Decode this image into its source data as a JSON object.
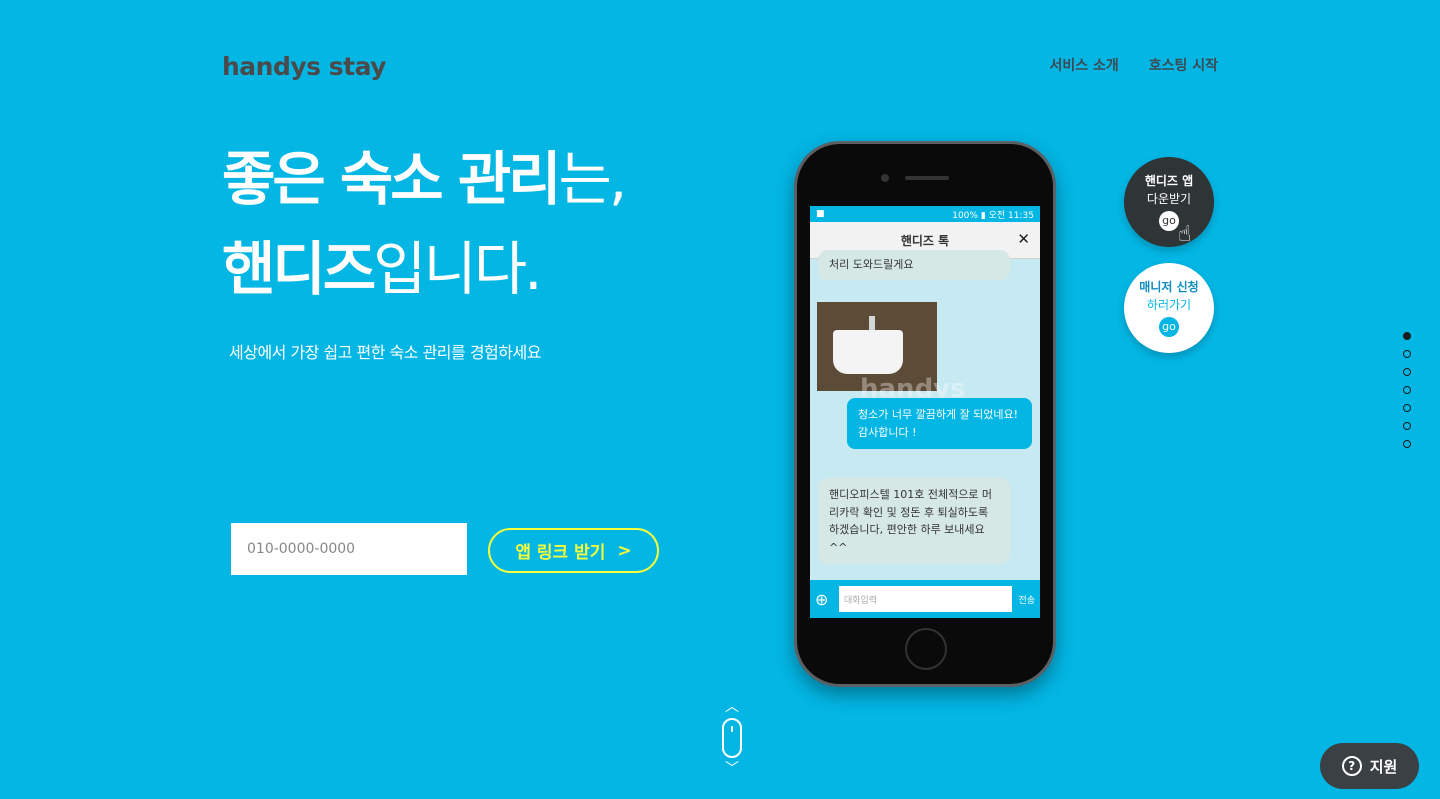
{
  "brand": {
    "logo": "handys stay"
  },
  "nav": {
    "items": [
      {
        "label": "서비스 소개"
      },
      {
        "label": "호스팅 시작"
      }
    ]
  },
  "hero": {
    "line1": {
      "bold": "좋은 숙소 관리",
      "thin": "는,"
    },
    "line2": {
      "bold": "핸디즈",
      "thin": "입니다."
    },
    "subtitle": "세상에서 가장 쉽고 편한 숙소 관리를 경험하세요"
  },
  "form": {
    "phone_placeholder": "010-0000-0000",
    "button_label": "앱 링크 받기",
    "button_arrow": ">"
  },
  "phone_screen": {
    "status_left": "■",
    "status_right": "100% ▮ 오전 11:35",
    "chat_title": "핸디즈 톡",
    "close": "✕",
    "watermark": "handys",
    "messages": [
      {
        "text": "처리 도와드릴게요"
      },
      {
        "text": "청소가 너무 깔끔하게 잘 되었네요! 감사합니다 !"
      },
      {
        "text": "핸디오피스텔 101호 전체적으로 머리카락 확인 및 정돈 후 퇴실하도록 하겠습니다, 편안한 하루 보내세요^^"
      }
    ],
    "input_placeholder": "대화입력",
    "send_label": "전송"
  },
  "badges": {
    "app": {
      "title": "핸디즈 앱",
      "sub": "다운받기",
      "go": "go"
    },
    "manager": {
      "title": "매니저 신청",
      "sub": "하러가기",
      "go": "go"
    }
  },
  "pager": {
    "count": 7,
    "active": 0
  },
  "support": {
    "label": "지원",
    "icon": "?"
  },
  "colors": {
    "background": "#03b6e4",
    "accent": "#f5ff3a",
    "dark": "#2f3437"
  }
}
